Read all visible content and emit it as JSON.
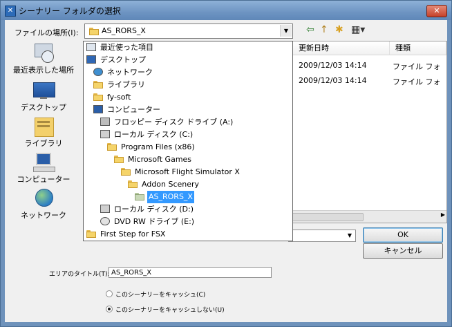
{
  "window": {
    "title": "シーナリー フォルダの選択",
    "close_glyph": "✕"
  },
  "lookin": {
    "label": "ファイルの場所(I):",
    "value": "AS_RORS_X"
  },
  "toolbar": {
    "back_glyph": "⇦",
    "up_glyph": "↑",
    "new_folder_glyph": "✱",
    "view_glyph": "▦▾"
  },
  "places": [
    {
      "label": "最近表示した場所",
      "icon": "recent-places-icon"
    },
    {
      "label": "デスクトップ",
      "icon": "desktop-icon"
    },
    {
      "label": "ライブラリ",
      "icon": "library-icon"
    },
    {
      "label": "コンピューター",
      "icon": "computer-icon"
    },
    {
      "label": "ネットワーク",
      "icon": "network-icon"
    }
  ],
  "filelist": {
    "columns": [
      "更新日時",
      "種類"
    ],
    "rows": [
      {
        "date": "2009/12/03 14:14",
        "type": "ファイル フォ"
      },
      {
        "date": "2009/12/03 14:14",
        "type": "ファイル フォ"
      }
    ]
  },
  "dropdown": {
    "items": [
      {
        "label": "最近使った項目",
        "icon": "recent-items-icon"
      },
      {
        "label": "デスクトップ",
        "icon": "desktop-icon"
      },
      {
        "label": "ネットワーク",
        "icon": "network-icon"
      },
      {
        "label": "ライブラリ",
        "icon": "library-icon"
      },
      {
        "label": "fy-soft",
        "icon": "user-folder-icon"
      },
      {
        "label": "コンピューター",
        "icon": "computer-icon"
      },
      {
        "label": "フロッピー ディスク ドライブ (A:)",
        "icon": "floppy-drive-icon"
      },
      {
        "label": "ローカル ディスク (C:)",
        "icon": "local-disk-icon"
      },
      {
        "label": "Program Files (x86)",
        "icon": "folder-icon"
      },
      {
        "label": "Microsoft Games",
        "icon": "folder-icon"
      },
      {
        "label": "Microsoft Flight Simulator X",
        "icon": "folder-icon"
      },
      {
        "label": "Addon Scenery",
        "icon": "folder-icon"
      },
      {
        "label": "AS_RORS_X",
        "icon": "folder-icon"
      },
      {
        "label": "ローカル ディスク (D:)",
        "icon": "local-disk-icon"
      },
      {
        "label": "DVD RW ドライブ (E:)",
        "icon": "dvd-drive-icon"
      },
      {
        "label": "First Step for FSX",
        "icon": "folder-icon"
      }
    ]
  },
  "buttons": {
    "ok": "OK",
    "cancel": "キャンセル"
  },
  "area_title": {
    "label": "エリアのタイトル(T):",
    "value": "AS_RORS_X"
  },
  "radios": [
    {
      "label": "このシーナリーをキャッシュ(C)",
      "checked": false
    },
    {
      "label": "このシーナリーをキャッシュしない(U)",
      "checked": true
    }
  ],
  "colors": {
    "selection": "#3399ff",
    "titlebar": "#6d94c2",
    "close": "#c6412a"
  }
}
